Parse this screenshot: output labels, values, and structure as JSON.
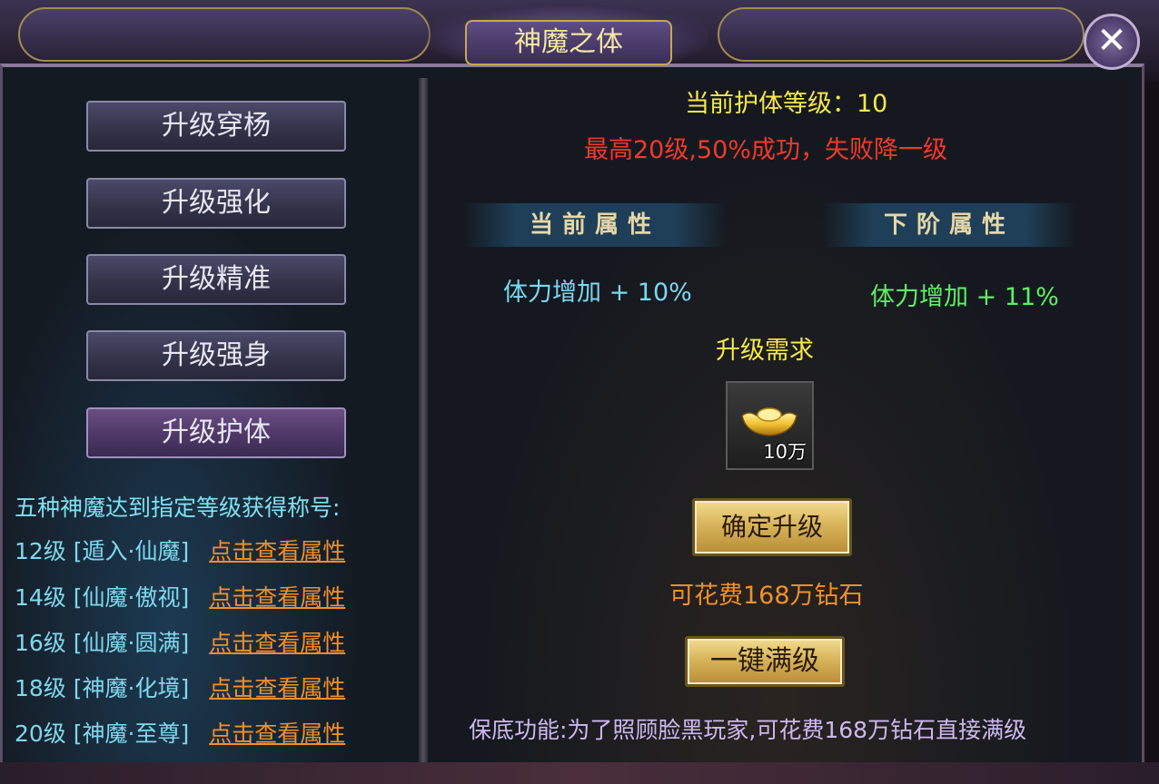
{
  "window": {
    "title": "神魔之体",
    "close_symbol": "✕"
  },
  "sidebar": {
    "buttons": [
      {
        "label": "升级穿杨",
        "active": false
      },
      {
        "label": "升级强化",
        "active": false
      },
      {
        "label": "升级精准",
        "active": false
      },
      {
        "label": "升级强身",
        "active": false
      },
      {
        "label": "升级护体",
        "active": true
      }
    ],
    "titles_heading": "五种神魔达到指定等级获得称号:",
    "tiers": [
      {
        "level": "12级",
        "name": "[遁入·仙魔]",
        "link": "点击查看属性"
      },
      {
        "level": "14级",
        "name": "[仙魔·傲视]",
        "link": "点击查看属性"
      },
      {
        "level": "16级",
        "name": "[仙魔·圆满]",
        "link": "点击查看属性"
      },
      {
        "level": "18级",
        "name": "[神魔·化境]",
        "link": "点击查看属性"
      },
      {
        "level": "20级",
        "name": "[神魔·至尊]",
        "link": "点击查看属性"
      }
    ]
  },
  "main": {
    "current_level_text": "当前护体等级：10",
    "rule_text": "最高20级,50%成功，失败降一级",
    "current_attr_header": "当前属性",
    "next_attr_header": "下阶属性",
    "current_attr": "体力增加 + 10%",
    "next_attr": "体力增加 + 11%",
    "requirement_label": "升级需求",
    "item": {
      "icon": "gold-ingot-icon",
      "quantity": "10万"
    },
    "confirm_button": "确定升级",
    "cost_text": "可花费168万钻石",
    "max_level_button": "一键满级",
    "guarantee_text": "保底功能:为了照顾脸黑玩家,可花费168万钻石直接满级"
  },
  "colors": {
    "yellow_text": "#f6e84a",
    "red_text": "#ee3a2a",
    "cyan_text": "#7ad8f0",
    "green_text": "#5ef064",
    "orange_link": "#f0902a",
    "lavender_text": "#cdb8f0"
  }
}
